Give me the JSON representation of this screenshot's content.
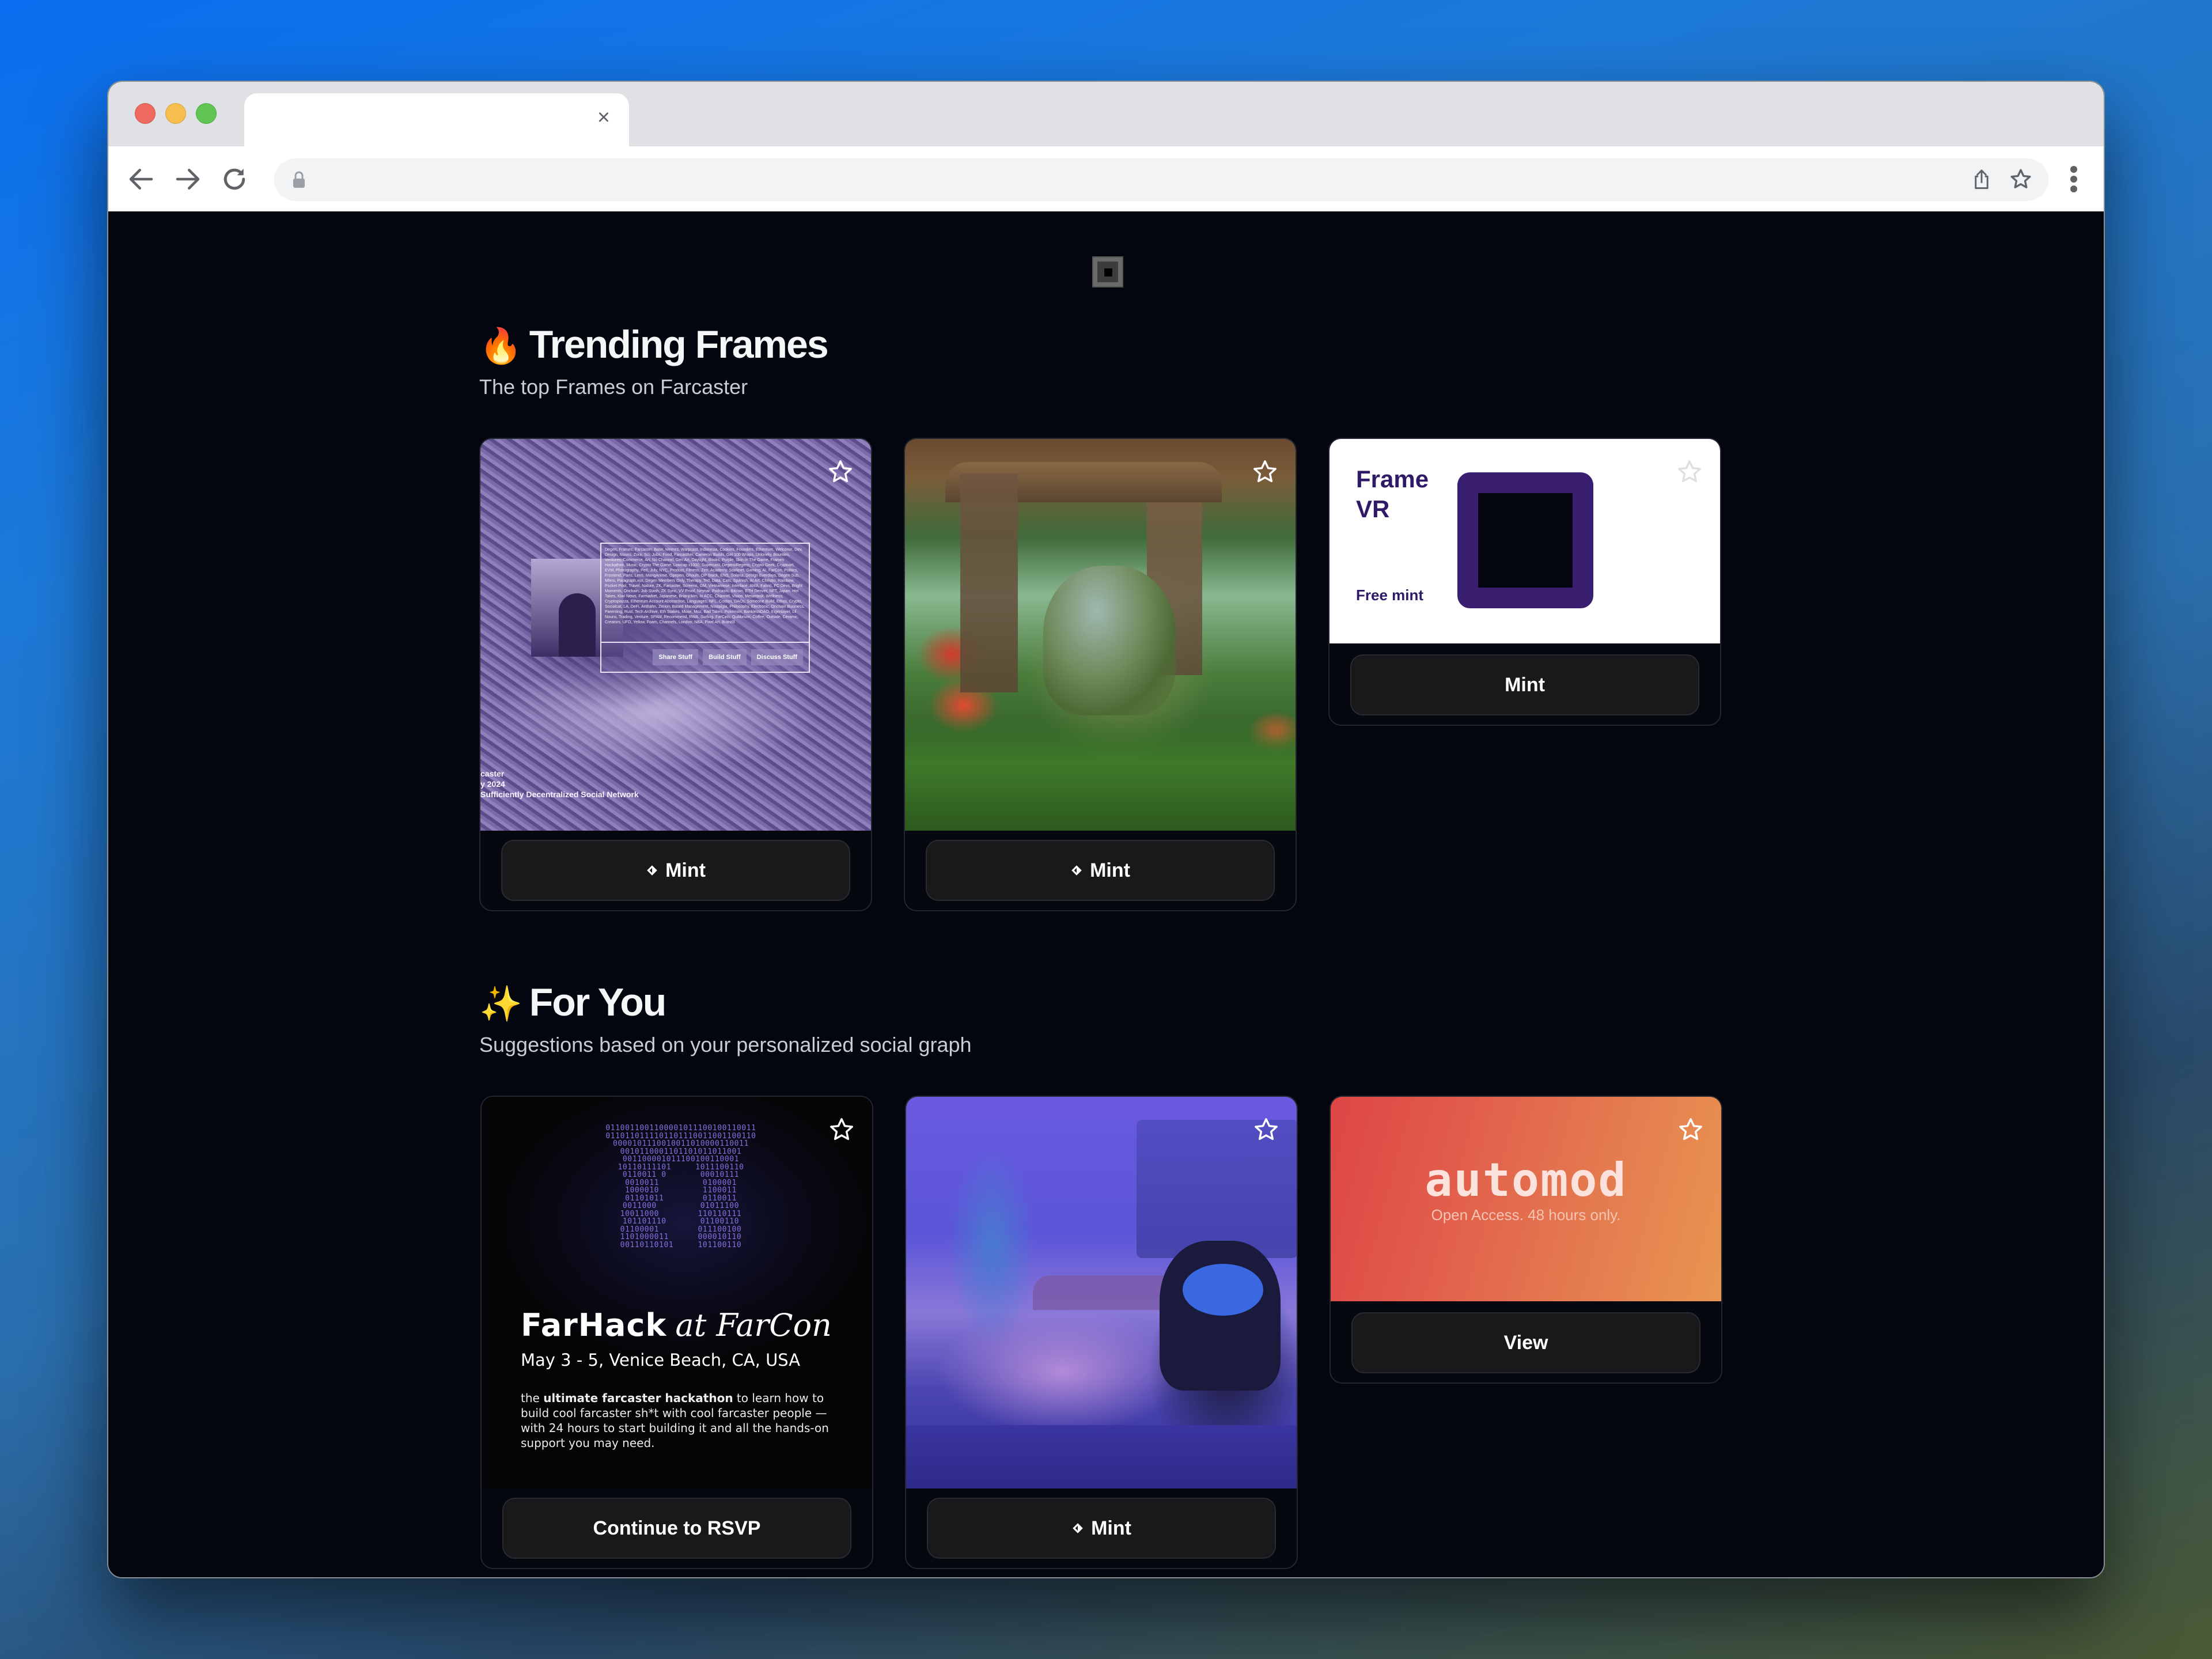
{
  "browser": {
    "tab_title": "",
    "tab_close_icon": "close-icon",
    "url": "",
    "nav": [
      "back-icon",
      "forward-icon",
      "reload-icon"
    ],
    "omnibox_icons": [
      "lock-icon",
      "share-icon",
      "bookmark-star-icon"
    ],
    "menu_icon": "more-vert-icon"
  },
  "page": {
    "logo_icon": "frame-logo-icon",
    "sections": [
      {
        "emoji": "🔥",
        "title": "Trending Frames",
        "subtitle": "The top Frames on Farcaster",
        "cards": [
          {
            "image": "Purple-tinted aerial photo of Arc de Triomphe with Farcaster channel tags",
            "overlay_buttons": [
              "Share Stuff",
              "Build Stuff",
              "Discuss Stuff"
            ],
            "overlay_caption": [
              "caster",
              "y 2024",
              "Sufficiently Decentralized Social Network"
            ],
            "tags_text": "Degen, Frames, Farcaster, Base, Memes, Warpcast, Indonesia, Cookies, Founders, Ethereum, Welcome, Dev, Design, Nouns, Zora, Sci, Jobs, Food, Farcasther, Cameron Builds, Get 100 Wraps, Unlonely, Bounties, Ventures, Commerce, Art, No Channel, Gen Art, Daylight, Books, Purple, Skin In The Game, Frames Hackathon, Music, Crypto The Game, Lowcap x1000, Supercast, DegenxRegens, Crypto Geek, Cryptoart, EVM, Photography, Perl, July, NYC, Product, Fitness, Zen, Academy, Starknet, Gaming, AI, FarCon, Politics, Frontend, Paris, Lens, MangAnime, Opepen, Ghouls, OP Stack, ENS, Solana, Design Everdays, Degen Sub, Mfers, Paragraph.xyz, Degen Members Only, Therapy, Ted, Data, Cats, Spanish, AI Art, Christin, Rainbow, Pocket Pool, Travel, Nature, ZK, Farcaster, Screens, GM, Vietnamese, Interface, AMA, Fabric, FC Devs, Bright Moments, Onchain, Job Stash, ZK Sync, VV Proof, Neynar, Podcasts, Bitcoin, ETH Denver, NFT, Japan, Hot Takes, Kiwi News, Farmarket, Japanese, Brianjckim, In ACC, Channel, Vision, Metamask, Wellness, Cryptopiazza, Ethereum Account Abstraction, Languages, NFL, Coston, DAOs, Someone Build, Ethos, Crypto, Socialcat, LA, DeFi, Anthahn, Zerion, Based Management, Nostalgia, Philosophy, Electronic, Onchain Business, Parenting, Rust, Tech Archive, Eth Stakes, Muse, Moz, Bad Takes, Pokemon, BanklessDAO, Eigenlayer, Lil Nouns, Trading, Venture, SPAM, Recommend, RWA, Surfing, FarCats, Quilibrium, Coffee, Outside, Ceramic, Creators, UFO, Yellow, Foam, Channels, London, NBA, Pixel Art, Brand3",
            "button_label": "Mint",
            "button_icon": "eth-diamond-icon",
            "favorite_icon": "star-outline-icon"
          },
          {
            "image": "Painted iguana in a jungle ruin",
            "button_label": "Mint",
            "button_icon": "eth-diamond-icon",
            "favorite_icon": "star-outline-icon"
          },
          {
            "image": "Frame VR promo",
            "title_line1": "Frame",
            "title_line2": "VR",
            "tagline": "Free mint",
            "button_label": "Mint",
            "favorite_icon": "star-outline-icon"
          }
        ]
      },
      {
        "emoji": "✨",
        "title": "For You",
        "subtitle": "Suggestions based on your personalized social graph",
        "cards": [
          {
            "image": "FarHack event poster",
            "binary_art": "0110011001100001011100100110011\n0110110111101101110011001100110\n0000101110010011010000110011\n0010110001101101011011001\n001100001011100100110001\n10110111101     1011100110\n0110011 0       00010111\n0010011         0100001\n1000010         1100011\n01101011        0110011\n0011000         01011100\n10011000        110110111\n101101110       01100110\n01100001        011100100\n1101000011      000010110\n00110110101     101100110",
            "title_bold": "FarHack",
            "title_italic": "at FarCon",
            "date": "May 3 - 5, Venice Beach, CA, USA",
            "desc_prefix": "the ",
            "desc_bold": "ultimate farcaster hackathon",
            "desc_rest": " to learn how to build cool farcaster sh*t with cool farcaster people — with 24 hours to start building it and all the hands-on support you may need.",
            "button_label": "Continue to RSVP",
            "favorite_icon": "star-outline-icon"
          },
          {
            "image": "Stylized game art of characters in a purple fantasy town",
            "button_label": "Mint",
            "button_icon": "eth-diamond-icon",
            "favorite_icon": "star-outline-icon"
          },
          {
            "image": "automod banner",
            "title": "automod",
            "subtitle": "Open Access. 48 hours only.",
            "button_label": "View",
            "favorite_icon": "star-outline-icon"
          }
        ]
      }
    ]
  },
  "colors": {
    "page_bg": "#03060f",
    "card_border": "#23262e",
    "button_bg": "#19191b",
    "frame_vr_purple": "#3a1f70",
    "automod_start": "#de4545",
    "automod_end": "#e99551"
  }
}
